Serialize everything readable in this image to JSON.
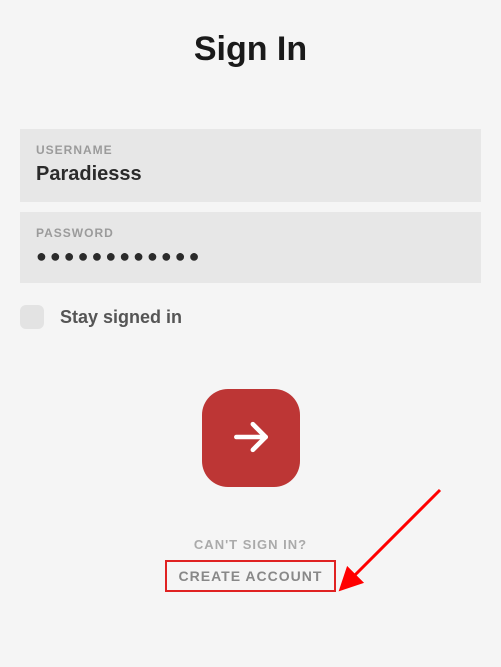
{
  "title": "Sign In",
  "fields": {
    "username": {
      "label": "USERNAME",
      "value": "Paradiesss"
    },
    "password": {
      "label": "PASSWORD",
      "mask": "●●●●●●●●●●●●"
    }
  },
  "stay": {
    "label": "Stay signed in",
    "checked": false
  },
  "links": {
    "cant_signin": "CAN'T SIGN IN?",
    "create_account": "CREATE ACCOUNT"
  },
  "icons": {
    "submit_arrow": "arrow-right-icon"
  },
  "colors": {
    "accent": "#bd3635",
    "highlight_border": "#e02222"
  }
}
